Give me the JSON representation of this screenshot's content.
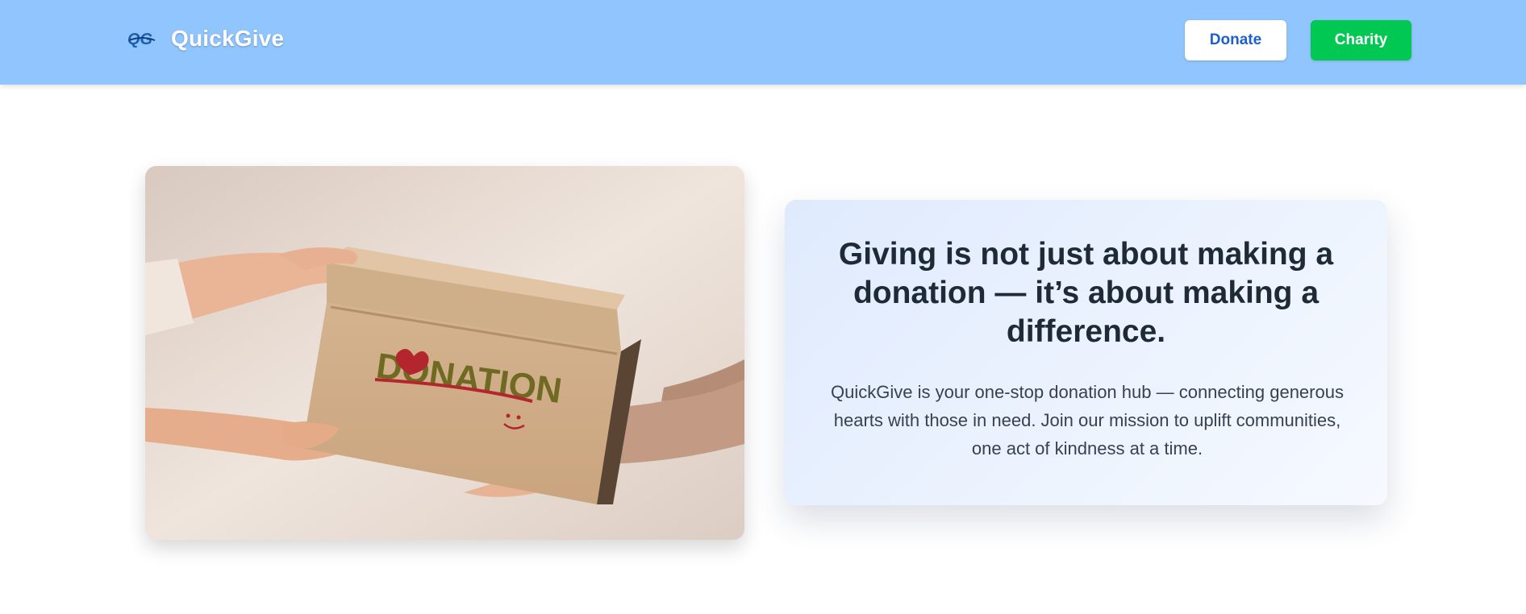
{
  "header": {
    "brand_name": "QuickGive",
    "logo_icon": "qg-logo-icon",
    "donate_label": "Donate",
    "charity_label": "Charity",
    "colors": {
      "navbar_bg": "#90c5fd",
      "donate_text": "#1d5fd0",
      "charity_bg": "#00c853"
    }
  },
  "hero": {
    "image_box_text": "DONATION",
    "heading": "Giving is not just about making a donation — it’s about making a difference.",
    "description": "QuickGive is your one-stop donation hub — connecting generous hearts with those in need. Join our mission to uplift communities, one act of kindness at a time."
  }
}
